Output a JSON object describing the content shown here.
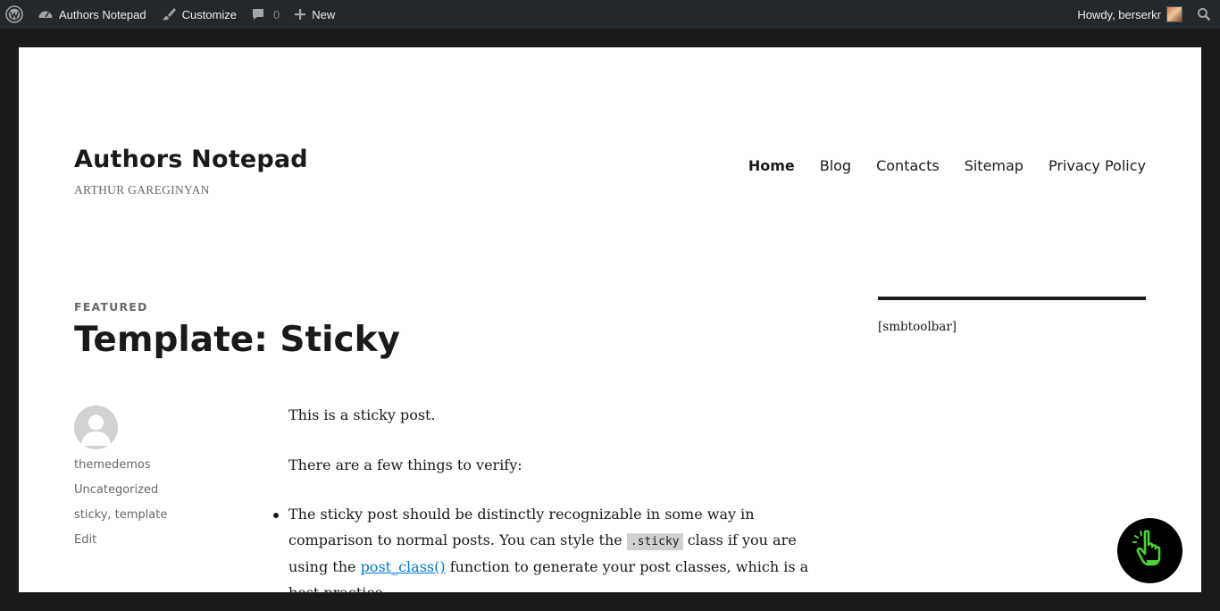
{
  "adminbar": {
    "site_name": "Authors Notepad",
    "customize": "Customize",
    "comments_count": "0",
    "new_label": "New",
    "greeting": "Howdy, berserkr"
  },
  "site": {
    "title": "Authors Notepad",
    "description": "ARTHUR GAREGINYAN"
  },
  "menu": {
    "items": [
      "Home",
      "Blog",
      "Contacts",
      "Sitemap",
      "Privacy Policy"
    ],
    "current": "Home"
  },
  "post": {
    "label": "FEATURED",
    "title": "Template: Sticky",
    "author": "themedemos",
    "category": "Uncategorized",
    "tags": "sticky, template",
    "edit": "Edit",
    "paragraph1": "This is a sticky post.",
    "paragraph2": "There are a few things to verify:",
    "bullet1_part1": "The sticky post should be distinctly recognizable in some way in comparison to normal posts. You can style the ",
    "bullet1_code": ".sticky",
    "bullet1_part2": " class if you are using the ",
    "bullet1_link": "post_class()",
    "bullet1_part3": " function to generate your post classes, which is a best practice."
  },
  "sidebar": {
    "widget_text": "[smbtoolbar]"
  },
  "colors": {
    "adminbar_bg": "#23282d",
    "link": "#007acc",
    "fab_icon": "#4cd137"
  },
  "icons": {
    "wp_logo": "wordpress-logo-icon",
    "site": "dashboard-icon",
    "customize": "brush-icon",
    "comments": "comment-icon",
    "new": "plus-icon",
    "search": "search-icon",
    "fab": "pointing-hand-icon"
  }
}
